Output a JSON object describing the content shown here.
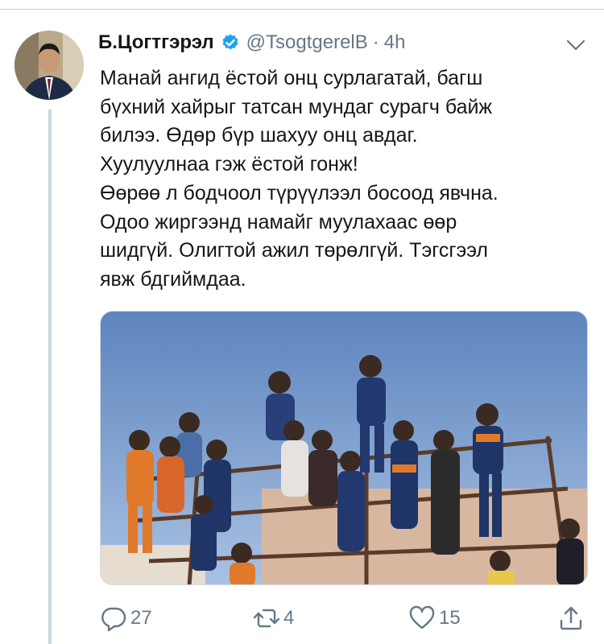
{
  "tweet": {
    "display_name": "Б.Цогтгэрэл",
    "handle": "@TsogtgerelB",
    "separator": "·",
    "time": "4h",
    "text_lines": [
      "Манай ангид ёстой онц сурлагатай, багш",
      "бүхний хайрыг татсан мундаг сурагч байж",
      "билээ. Өдөр бүр шахуу онц авдаг.",
      "Хуулуулнаа гэж ёстой гонж!",
      "Өөрөө л бодчоол түрүүлээл босоод явчна.",
      "Одоо жиргээнд намайг муулахаас өөр",
      "шидгүй. Олигтой ажил төрөлгүй. Тэгсгээл",
      "явж бдгиймдаа."
    ]
  },
  "actions": {
    "reply_count": "27",
    "retweet_count": "4",
    "like_count": "15"
  },
  "icons": {
    "verified": "verified-badge-icon",
    "menu": "chevron-down-icon",
    "reply": "reply-icon",
    "retweet": "retweet-icon",
    "like": "heart-icon",
    "share": "share-icon"
  },
  "colors": {
    "verified_blue": "#1da1f2",
    "secondary_text": "#657786",
    "thread_line": "#ccd6dd"
  }
}
